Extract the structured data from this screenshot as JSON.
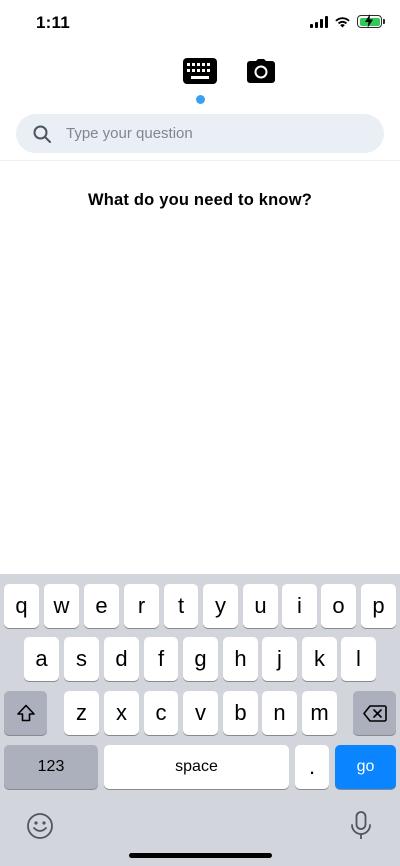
{
  "status_bar": {
    "time": "1:11"
  },
  "mode_tabs": {
    "icons": [
      "keyboard-icon",
      "camera-icon"
    ],
    "active": "keyboard",
    "indicator_color": "#3aa0f0"
  },
  "search": {
    "placeholder": "Type your question",
    "value": ""
  },
  "prompt": {
    "text": "What do you need to know?"
  },
  "keyboard": {
    "row1": [
      "q",
      "w",
      "e",
      "r",
      "t",
      "y",
      "u",
      "i",
      "o",
      "p"
    ],
    "row2": [
      "a",
      "s",
      "d",
      "f",
      "g",
      "h",
      "j",
      "k",
      "l"
    ],
    "row3": [
      "z",
      "x",
      "c",
      "v",
      "b",
      "n",
      "m"
    ],
    "numbers_label": "123",
    "space_label": "space",
    "period_label": ".",
    "go_label": "go",
    "go_color": "#0a84ff"
  }
}
